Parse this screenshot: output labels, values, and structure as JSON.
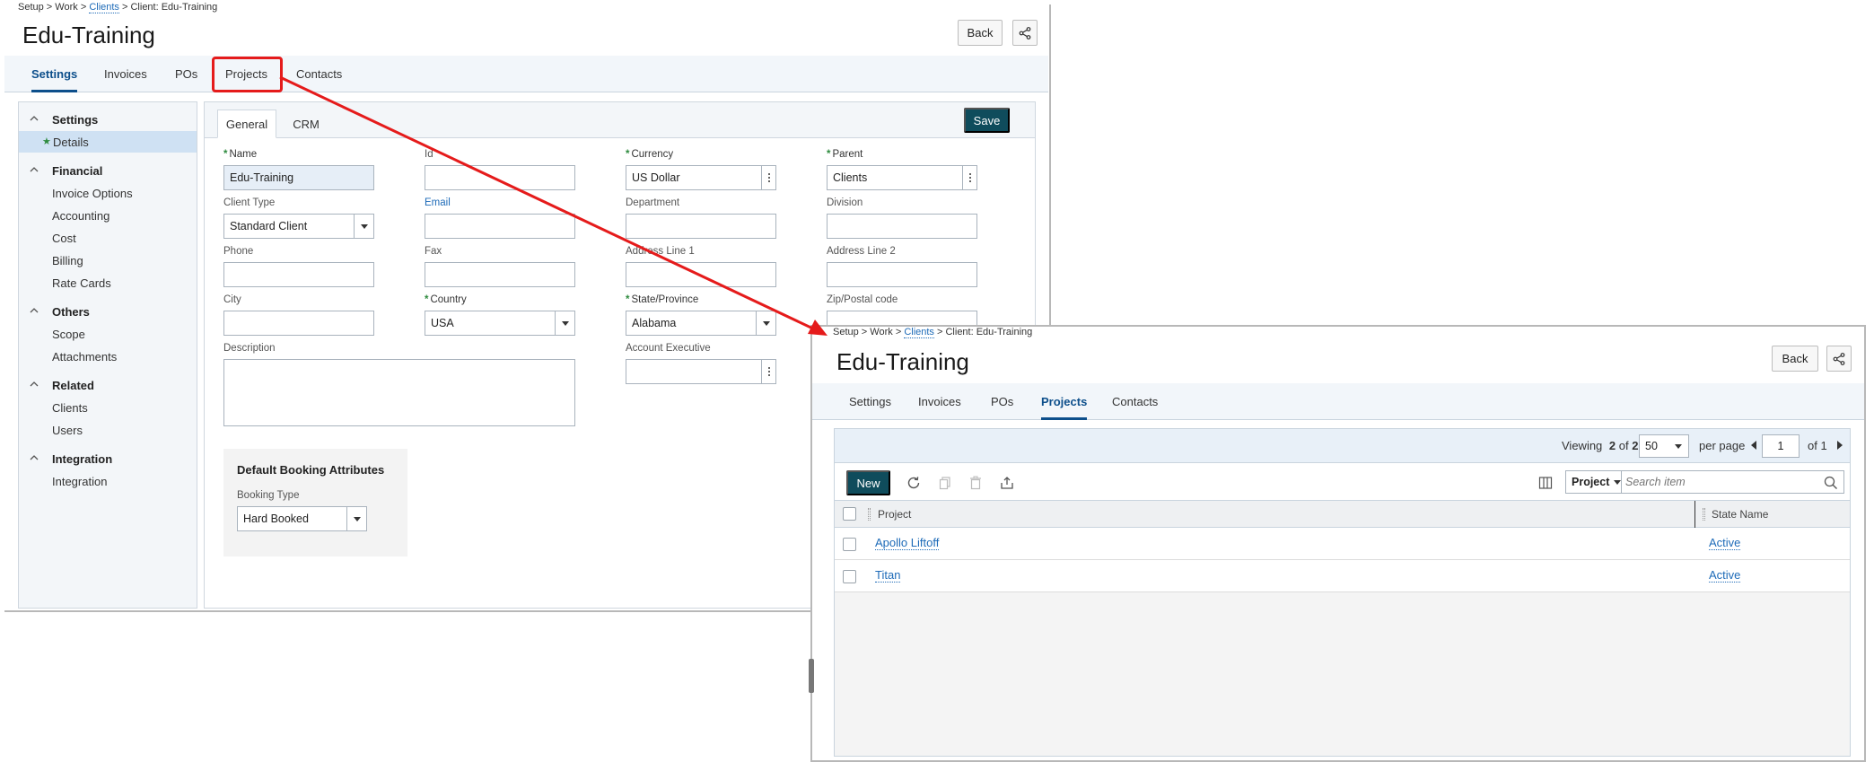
{
  "left": {
    "breadcrumb": {
      "setup": "Setup",
      "sep1": " > ",
      "work": "Work",
      "sep2": " > ",
      "clients": "Clients",
      "sep3": " > ",
      "current": "Client: Edu-Training"
    },
    "title": "Edu-Training",
    "back_label": "Back",
    "tabs": [
      {
        "label": "Settings",
        "active": true
      },
      {
        "label": "Invoices"
      },
      {
        "label": "POs"
      },
      {
        "label": "Projects"
      },
      {
        "label": "Contacts"
      }
    ],
    "nav": {
      "settings": "Settings",
      "details": "Details",
      "financial": "Financial",
      "invoice_options": "Invoice Options",
      "accounting": "Accounting",
      "cost": "Cost",
      "billing": "Billing",
      "rate_cards": "Rate Cards",
      "others": "Others",
      "scope": "Scope",
      "attachments": "Attachments",
      "related": "Related",
      "clients": "Clients",
      "users": "Users",
      "integration_group": "Integration",
      "integration": "Integration"
    },
    "subtabs": {
      "general": "General",
      "crm": "CRM"
    },
    "save_label": "Save",
    "form": {
      "name_label": "Name",
      "name_value": "Edu-Training",
      "id_label": "Id",
      "id_value": "",
      "currency_label": "Currency",
      "currency_value": "US Dollar",
      "parent_label": "Parent",
      "parent_value": "Clients",
      "client_type_label": "Client Type",
      "client_type_value": "Standard Client",
      "email_label": "Email",
      "email_value": "",
      "department_label": "Department",
      "department_value": "",
      "division_label": "Division",
      "division_value": "",
      "phone_label": "Phone",
      "phone_value": "",
      "fax_label": "Fax",
      "fax_value": "",
      "address1_label": "Address Line 1",
      "address1_value": "",
      "address2_label": "Address Line 2",
      "address2_value": "",
      "city_label": "City",
      "city_value": "",
      "country_label": "Country",
      "country_value": "USA",
      "state_label": "State/Province",
      "state_value": "Alabama",
      "zip_label": "Zip/Postal code",
      "zip_value": "",
      "description_label": "Description",
      "account_exec_label": "Account Executive",
      "account_exec_value": "",
      "booking_heading": "Default Booking Attributes",
      "booking_type_label": "Booking Type",
      "booking_type_value": "Hard Booked"
    }
  },
  "right": {
    "breadcrumb": {
      "setup": "Setup",
      "sep1": " > ",
      "work": "Work",
      "sep2": " > ",
      "clients": "Clients",
      "sep3": " > ",
      "current": "Client: Edu-Training"
    },
    "title": "Edu-Training",
    "back_label": "Back",
    "tabs": [
      {
        "label": "Settings"
      },
      {
        "label": "Invoices"
      },
      {
        "label": "POs"
      },
      {
        "label": "Projects",
        "active": true
      },
      {
        "label": "Contacts"
      }
    ],
    "pager": {
      "viewing": "Viewing",
      "shown": "2",
      "of_text": "of",
      "total": "2",
      "per_page_value": "50",
      "per_page_label": "per page",
      "page_value": "1",
      "of_pages": "of 1"
    },
    "toolbar": {
      "new_label": "New",
      "filter_field": "Project",
      "search_placeholder": "Search item"
    },
    "columns": {
      "project": "Project",
      "state": "State Name"
    },
    "rows": [
      {
        "project": "Apollo Liftoff",
        "state": "Active"
      },
      {
        "project": "Titan",
        "state": "Active"
      }
    ]
  },
  "colors": {
    "primary_button": "#0f4c5c",
    "active_tab": "#0d4f8b",
    "link": "#1e6bb8",
    "callout": "#e51b1b",
    "required_asterisk": "#2e8b3e"
  }
}
